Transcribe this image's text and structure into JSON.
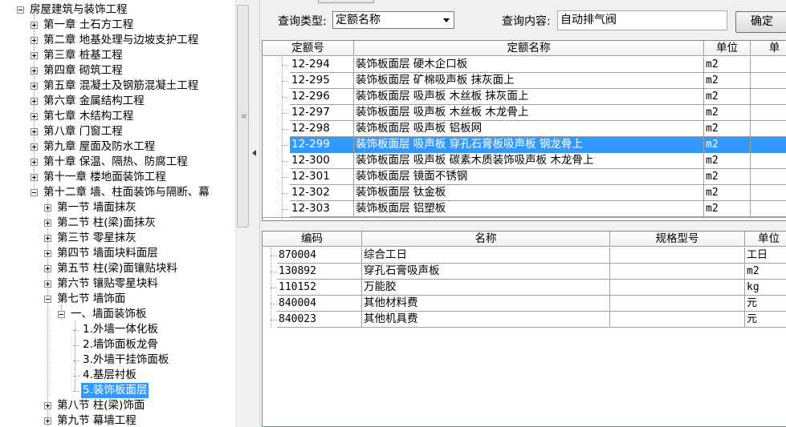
{
  "tree": {
    "root": "房屋建筑与装饰工程",
    "chapters": [
      "第一章 土石方工程",
      "第二章 地基处理与边坡支护工程",
      "第三章 桩基工程",
      "第四章 砌筑工程",
      "第五章 混凝土及钢筋混凝土工程",
      "第六章 金属结构工程",
      "第七章 木结构工程",
      "第八章 门窗工程",
      "第九章 屋面及防水工程",
      "第十章 保温、隔热、防腐工程",
      "第十一章 楼地面装饰工程",
      "第十二章 墙、柱面装饰与隔断、幕"
    ],
    "sections": [
      "第一节 墙面抹灰",
      "第二节 柱(梁)面抹灰",
      "第三节 零星抹灰",
      "第四节 墙面块料面层",
      "第五节 柱(梁)面镶贴块料",
      "第六节 镶贴零星块料",
      "第七节 墙饰面"
    ],
    "subsection": "一、墙面装饰板",
    "items": [
      "1.外墙一体化板",
      "2.墙饰面板龙骨",
      "3.外墙干挂饰面板",
      "4.基层衬板",
      "5.装饰板面层"
    ],
    "after_sections": [
      "第八节 柱(梁)饰面",
      "第九节 幕墙工程"
    ]
  },
  "query": {
    "type_label": "查询类型:",
    "type_value": "定额名称",
    "content_label": "查询内容:",
    "content_value": "自动排气阀",
    "button_label": "确定"
  },
  "upper_grid": {
    "columns": [
      "定额号",
      "定额名称",
      "单位",
      "单"
    ],
    "rows": [
      {
        "code": "12-294",
        "name": "装饰板面层 硬木企口板",
        "unit": "m2"
      },
      {
        "code": "12-295",
        "name": "装饰板面层 矿棉吸声板 抹灰面上",
        "unit": "m2"
      },
      {
        "code": "12-296",
        "name": "装饰板面层 吸声板 木丝板 抹灰面上",
        "unit": "m2"
      },
      {
        "code": "12-297",
        "name": "装饰板面层 吸声板 木丝板 木龙骨上",
        "unit": "m2"
      },
      {
        "code": "12-298",
        "name": "装饰板面层 吸声板 铝板网",
        "unit": "m2"
      },
      {
        "code": "12-299",
        "name": "装饰板面层 吸声板 穿孔石膏板吸声板 钢龙骨上",
        "unit": "m2"
      },
      {
        "code": "12-300",
        "name": "装饰板面层 吸声板 碳素木质装饰吸声板 木龙骨上",
        "unit": "m2"
      },
      {
        "code": "12-301",
        "name": "装饰板面层 镜面不锈钢",
        "unit": "m2"
      },
      {
        "code": "12-302",
        "name": "装饰板面层 钛金板",
        "unit": "m2"
      },
      {
        "code": "12-303",
        "name": "装饰板面层 铝塑板",
        "unit": "m2"
      }
    ],
    "selected_index": 5
  },
  "lower_grid": {
    "columns": [
      "编码",
      "名称",
      "规格型号",
      "单位"
    ],
    "rows": [
      {
        "code": "870004",
        "name": "综合工日",
        "spec": "",
        "unit": "工日"
      },
      {
        "code": "130892",
        "name": "穿孔石膏吸声板",
        "spec": "",
        "unit": "m2"
      },
      {
        "code": "110152",
        "name": "万能胶",
        "spec": "",
        "unit": "kg"
      },
      {
        "code": "840004",
        "name": "其他材料费",
        "spec": "",
        "unit": "元"
      },
      {
        "code": "840023",
        "name": "其他机具费",
        "spec": "",
        "unit": "元"
      }
    ]
  },
  "colors": {
    "selection": "#3399ff",
    "background": "#f0f0f0",
    "grid_line": "#a0a0a0"
  }
}
